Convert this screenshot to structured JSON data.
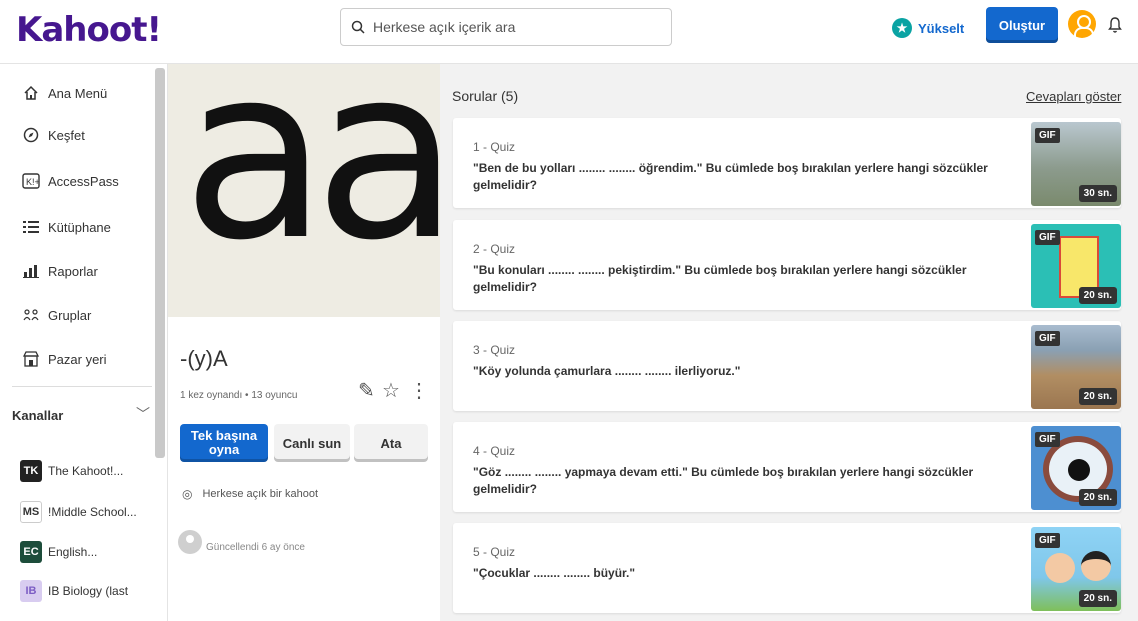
{
  "header": {
    "logo": "Kahoot!",
    "search_placeholder": "Herkese açık içerik ara",
    "upgrade_label": "Yükselt",
    "create_label": "Oluştur"
  },
  "sidebar": {
    "items": [
      {
        "label": "Ana Menü",
        "icon": "home-icon"
      },
      {
        "label": "Keşfet",
        "icon": "compass-icon"
      },
      {
        "label": "AccessPass",
        "icon": "access-pass-icon"
      },
      {
        "label": "Kütüphane",
        "icon": "list-icon"
      },
      {
        "label": "Raporlar",
        "icon": "bar-chart-icon"
      },
      {
        "label": "Gruplar",
        "icon": "groups-icon"
      },
      {
        "label": "Pazar yeri",
        "icon": "store-icon"
      }
    ],
    "channels_title": "Kanallar",
    "channels": [
      {
        "badge": "TK",
        "name": "The Kahoot!...",
        "color": "#222222"
      },
      {
        "badge": "MS",
        "name": "!Middle School...",
        "color": "#ffffff"
      },
      {
        "badge": "EC",
        "name": "English...",
        "color": "#1d4d3b"
      },
      {
        "badge": "IB",
        "name": "IB Biology (last",
        "color": "#7c5cc4"
      }
    ]
  },
  "kahoot": {
    "cover_text": "aa",
    "title": "-(y)A",
    "meta": "1 kez oynandı • 13 oyuncu",
    "play_solo_label": "Tek başına oyna",
    "host_live_label": "Canlı sun",
    "assign_label": "Ata",
    "visibility": "Herkese açık bir kahoot",
    "updated": "Güncellendi 6 ay önce"
  },
  "questions": {
    "header": "Sorular (5)",
    "show_answers": "Cevapları göster",
    "items": [
      {
        "type": "1 - Quiz",
        "text": "\"Ben de bu yolları ........ ........ öğrendim.\" Bu cümlede boş bırakılan yerlere hangi sözcükler gelmelidir?",
        "media": "GIF",
        "time": "30 sn.",
        "thumb": "#8a9a8c"
      },
      {
        "type": "2 - Quiz",
        "text": "\"Bu konuları ........ ........ pekiştirdim.\" Bu cümlede boş bırakılan yerlere hangi sözcükler gelmelidir?",
        "media": "GIF",
        "time": "20 sn.",
        "thumb": "#2bbfb5"
      },
      {
        "type": "3 - Quiz",
        "text": "\"Köy yolunda çamurlara ........ ........ ilerliyoruz.\"",
        "media": "GIF",
        "time": "20 sn.",
        "thumb": "#a58561"
      },
      {
        "type": "4 - Quiz",
        "text": "\"Göz ........ ........ yapmaya devam etti.\" Bu cümlede boş bırakılan yerlere hangi sözcükler gelmelidir?",
        "media": "GIF",
        "time": "20 sn.",
        "thumb": "#4d8fd1"
      },
      {
        "type": "5 - Quiz",
        "text": "\"Çocuklar ........ ........ büyür.\"",
        "media": "GIF",
        "time": "20 sn.",
        "thumb": "#7fc7ea"
      }
    ]
  }
}
